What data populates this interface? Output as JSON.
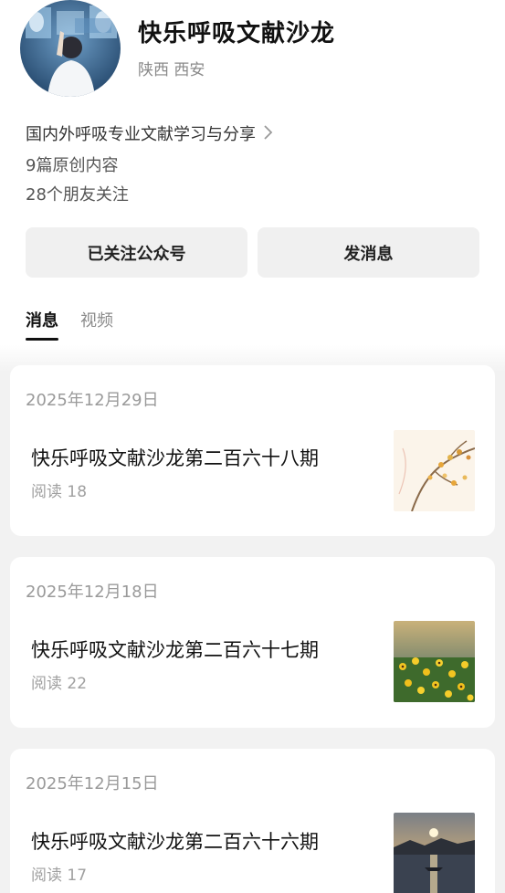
{
  "profile": {
    "name": "快乐呼吸文献沙龙",
    "location": "陕西 西安",
    "description": "国内外呼吸专业文献学习与分享",
    "articles_count": "9篇原创内容",
    "followers_count": "28个朋友关注"
  },
  "actions": {
    "follow_label": "已关注公众号",
    "message_label": "发消息"
  },
  "tabs": [
    {
      "label": "消息",
      "active": true
    },
    {
      "label": "视频",
      "active": false
    }
  ],
  "feed": [
    {
      "date": "2025年12月29日",
      "title": "快乐呼吸文献沙龙第二百六十八期",
      "reads": "阅读 18",
      "thumbnail": "autumn-branches-thumbnail"
    },
    {
      "date": "2025年12月18日",
      "title": "快乐呼吸文献沙龙第二百六十七期",
      "reads": "阅读 22",
      "thumbnail": "yellow-flowers-thumbnail"
    },
    {
      "date": "2025年12月15日",
      "title": "快乐呼吸文献沙龙第二百六十六期",
      "reads": "阅读 17",
      "thumbnail": "sunset-lake-thumbnail"
    }
  ],
  "icons": {
    "description_chevron": "chevron-right-icon"
  }
}
